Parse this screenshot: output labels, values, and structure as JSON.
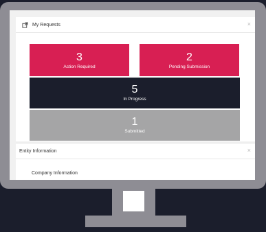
{
  "requests_panel": {
    "title": "My Requests",
    "close_icon": "×",
    "tiles": [
      {
        "count": "3",
        "label": "Action Required",
        "color": "#d81f53"
      },
      {
        "count": "2",
        "label": "Pending Submission",
        "color": "#d81f53"
      },
      {
        "count": "5",
        "label": "In Progress",
        "color": "#1b1e2c"
      },
      {
        "count": "1",
        "label": "Submitted",
        "color": "#a5a5a6"
      }
    ]
  },
  "entity_panel": {
    "title": "Entity Information",
    "close_icon": "×",
    "section_label": "Company Information"
  },
  "icons": {
    "header_icon": "external-link-icon",
    "close": "close-icon"
  },
  "colors": {
    "background": "#1b1e2c",
    "monitor": "#8e8d94",
    "accent": "#d81f53",
    "dark_tile": "#1b1e2c",
    "gray_tile": "#a5a5a6"
  }
}
